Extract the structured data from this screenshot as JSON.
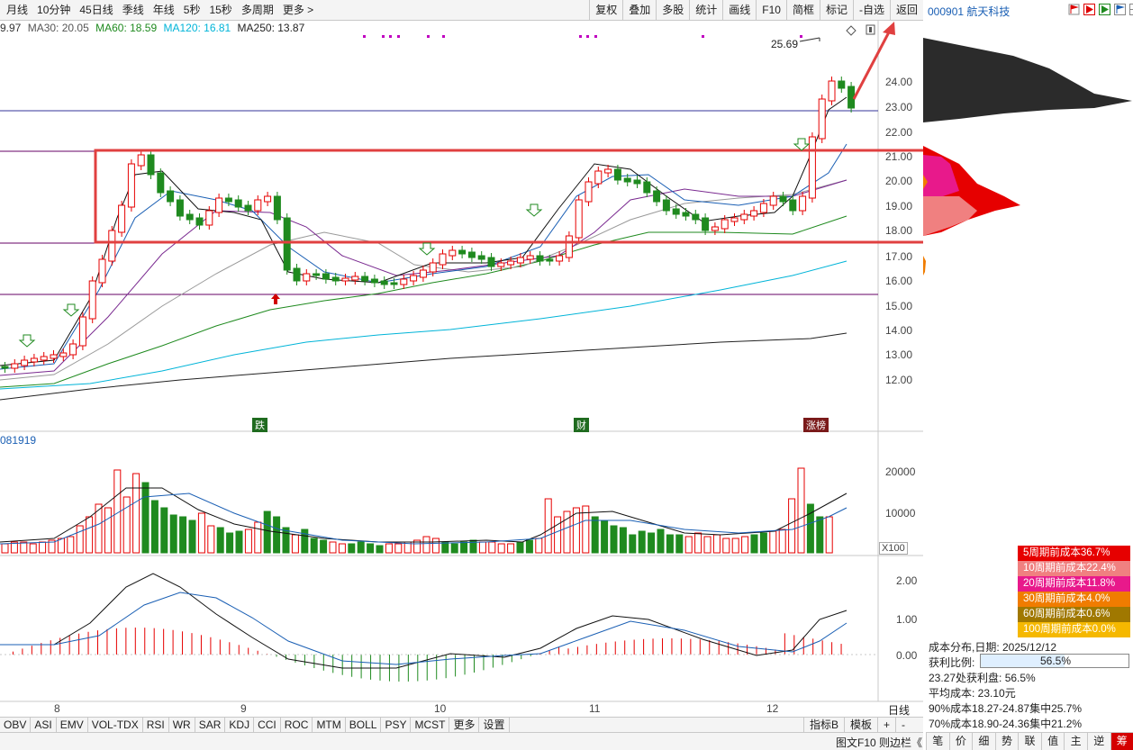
{
  "toolbar": {
    "periods": [
      "月线",
      "10分钟",
      "45日线",
      "季线",
      "年线",
      "5秒",
      "15秒",
      "多周期",
      "更多 >"
    ],
    "actions": [
      "复权",
      "叠加",
      "多股",
      "统计",
      "画线",
      "F10",
      "简框",
      "标记",
      "-自选",
      "返回"
    ]
  },
  "stock": {
    "code_name": "000901 航天科技"
  },
  "ma_legend": {
    "ma_first": "9.97",
    "ma30": "MA30: 20.05",
    "ma60": "MA60: 18.59",
    "ma120": "MA120: 16.81",
    "ma250": "MA250: 13.87"
  },
  "price_axis": [
    "24.00",
    "23.00",
    "22.00",
    "21.00",
    "20.00",
    "19.00",
    "18.00",
    "17.00",
    "16.00",
    "15.00",
    "14.00",
    "13.00",
    "12.00"
  ],
  "peak_label": "25.69",
  "event_labels": {
    "e1": "跌",
    "e2": "财",
    "e3": "涨榜"
  },
  "volume": {
    "title": "081919",
    "axis": [
      "20000",
      "10000"
    ],
    "unit": "X100"
  },
  "macd": {
    "axis": [
      "2.00",
      "1.00",
      "0.00"
    ]
  },
  "date_axis": [
    "8",
    "9",
    "10",
    "11",
    "12"
  ],
  "period_label": "日线",
  "indicator_tabs": [
    "OBV",
    "ASI",
    "EMV",
    "VOL-TDX",
    "RSI",
    "WR",
    "SAR",
    "KDJ",
    "CCI",
    "ROC",
    "MTM",
    "BOLL",
    "PSY",
    "MCST",
    "更多",
    "设置"
  ],
  "bottom_right_tabs": [
    "指标B",
    "模板",
    "+",
    "-"
  ],
  "bottom_bar": {
    "left": "图文F10",
    "mid": "则边栏《"
  },
  "right_bottom_tabs": [
    "笔",
    "价",
    "细",
    "势",
    "联",
    "值",
    "主",
    "逆",
    "筹"
  ],
  "cost_legend": [
    {
      "label": "5周期前成本36.7%",
      "color": "#e60000"
    },
    {
      "label": "10周期前成本22.4%",
      "color": "#f08080"
    },
    {
      "label": "20周期前成本11.8%",
      "color": "#e8198b"
    },
    {
      "label": "30周期前成本4.0%",
      "color": "#f07c00"
    },
    {
      "label": "60周期前成本0.6%",
      "color": "#a07800"
    },
    {
      "label": "100周期前成本0.0%",
      "color": "#f5b800"
    }
  ],
  "cost_stats": {
    "date_line": "成本分布,日期:  2025/12/12",
    "profit_label": "获利比例:",
    "profit_value": "56.5%",
    "profit_ratio": 0.565,
    "profit_line": "23.27处获利盘:  56.5%",
    "avg_cost": "平均成本:  23.10元",
    "c90": "90%成本18.27-24.87集中25.7%",
    "c70": "70%成本18.90-24.36集中21.2%"
  },
  "colors": {
    "up": "#e60000",
    "down": "#1f8a1f",
    "bg": "#ffffff",
    "box": "#e04040"
  }
}
